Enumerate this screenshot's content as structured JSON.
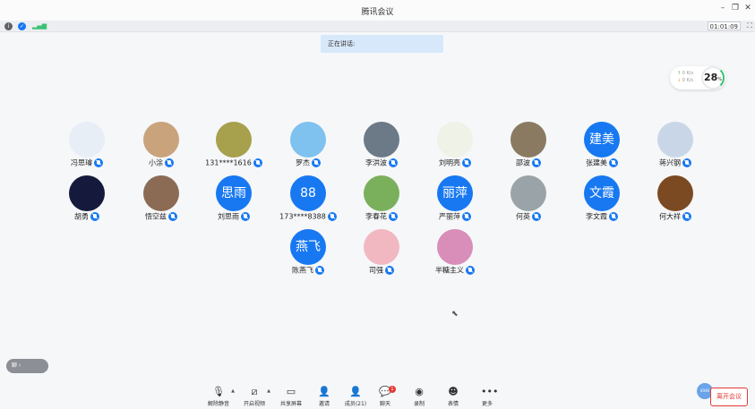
{
  "window": {
    "title": "腾讯会议"
  },
  "statusbar": {
    "timer": "01:01:09"
  },
  "speaking": {
    "label": "正在讲话:"
  },
  "network": {
    "up": "0 K/s",
    "down": "0 K/s",
    "quality": "28",
    "unit": "%"
  },
  "participants": [
    {
      "name": "冯思璿",
      "avatar_text": "",
      "avatar_color": "#e7eef6"
    },
    {
      "name": "小涂",
      "avatar_text": "",
      "avatar_color": "#c9a37c"
    },
    {
      "name": "131****1616",
      "avatar_text": "",
      "avatar_color": "#a7a04d"
    },
    {
      "name": "罗杰",
      "avatar_text": "",
      "avatar_color": "#7fc1ef"
    },
    {
      "name": "李洪波",
      "avatar_text": "",
      "avatar_color": "#6b7a86"
    },
    {
      "name": "刘明亮",
      "avatar_text": "",
      "avatar_color": "#eef2e7"
    },
    {
      "name": "邵波",
      "avatar_text": "",
      "avatar_color": "#8a7a62"
    },
    {
      "name": "张建美",
      "avatar_text": "建美",
      "avatar_color": "#1778f2"
    },
    {
      "name": "蒋兴钢",
      "avatar_text": "",
      "avatar_color": "#c8d6e8"
    },
    {
      "name": "胡勇",
      "avatar_text": "",
      "avatar_color": "#151a3d"
    },
    {
      "name": "悟空兹",
      "avatar_text": "",
      "avatar_color": "#8b6b54"
    },
    {
      "name": "刘思雨",
      "avatar_text": "思雨",
      "avatar_color": "#1778f2"
    },
    {
      "name": "173****8388",
      "avatar_text": "88",
      "avatar_color": "#1778f2"
    },
    {
      "name": "李春花",
      "avatar_text": "",
      "avatar_color": "#7ab05c"
    },
    {
      "name": "严丽萍",
      "avatar_text": "丽萍",
      "avatar_color": "#1778f2"
    },
    {
      "name": "何英",
      "avatar_text": "",
      "avatar_color": "#9aa4a8"
    },
    {
      "name": "李文霞",
      "avatar_text": "文霞",
      "avatar_color": "#1778f2"
    },
    {
      "name": "何大祥",
      "avatar_text": "",
      "avatar_color": "#7b4a22"
    },
    {
      "name": "陈燕飞",
      "avatar_text": "燕飞",
      "avatar_color": "#1778f2"
    },
    {
      "name": "司强",
      "avatar_text": "",
      "avatar_color": "#f2b8c1"
    },
    {
      "name": "半糖主义",
      "avatar_text": "",
      "avatar_color": "#d88eb8"
    }
  ],
  "chat_toggle": {
    "label": "聊 ‹"
  },
  "toolbar": {
    "mute": "解除静音",
    "video": "开启视频",
    "share": "共享屏幕",
    "invite": "邀请",
    "members": "成员(21)",
    "chat": "聊天",
    "chat_badge": "1",
    "record": "录制",
    "reactions": "表情",
    "more": "更多"
  },
  "leave_button": "离开会议",
  "user_chip": "4046"
}
